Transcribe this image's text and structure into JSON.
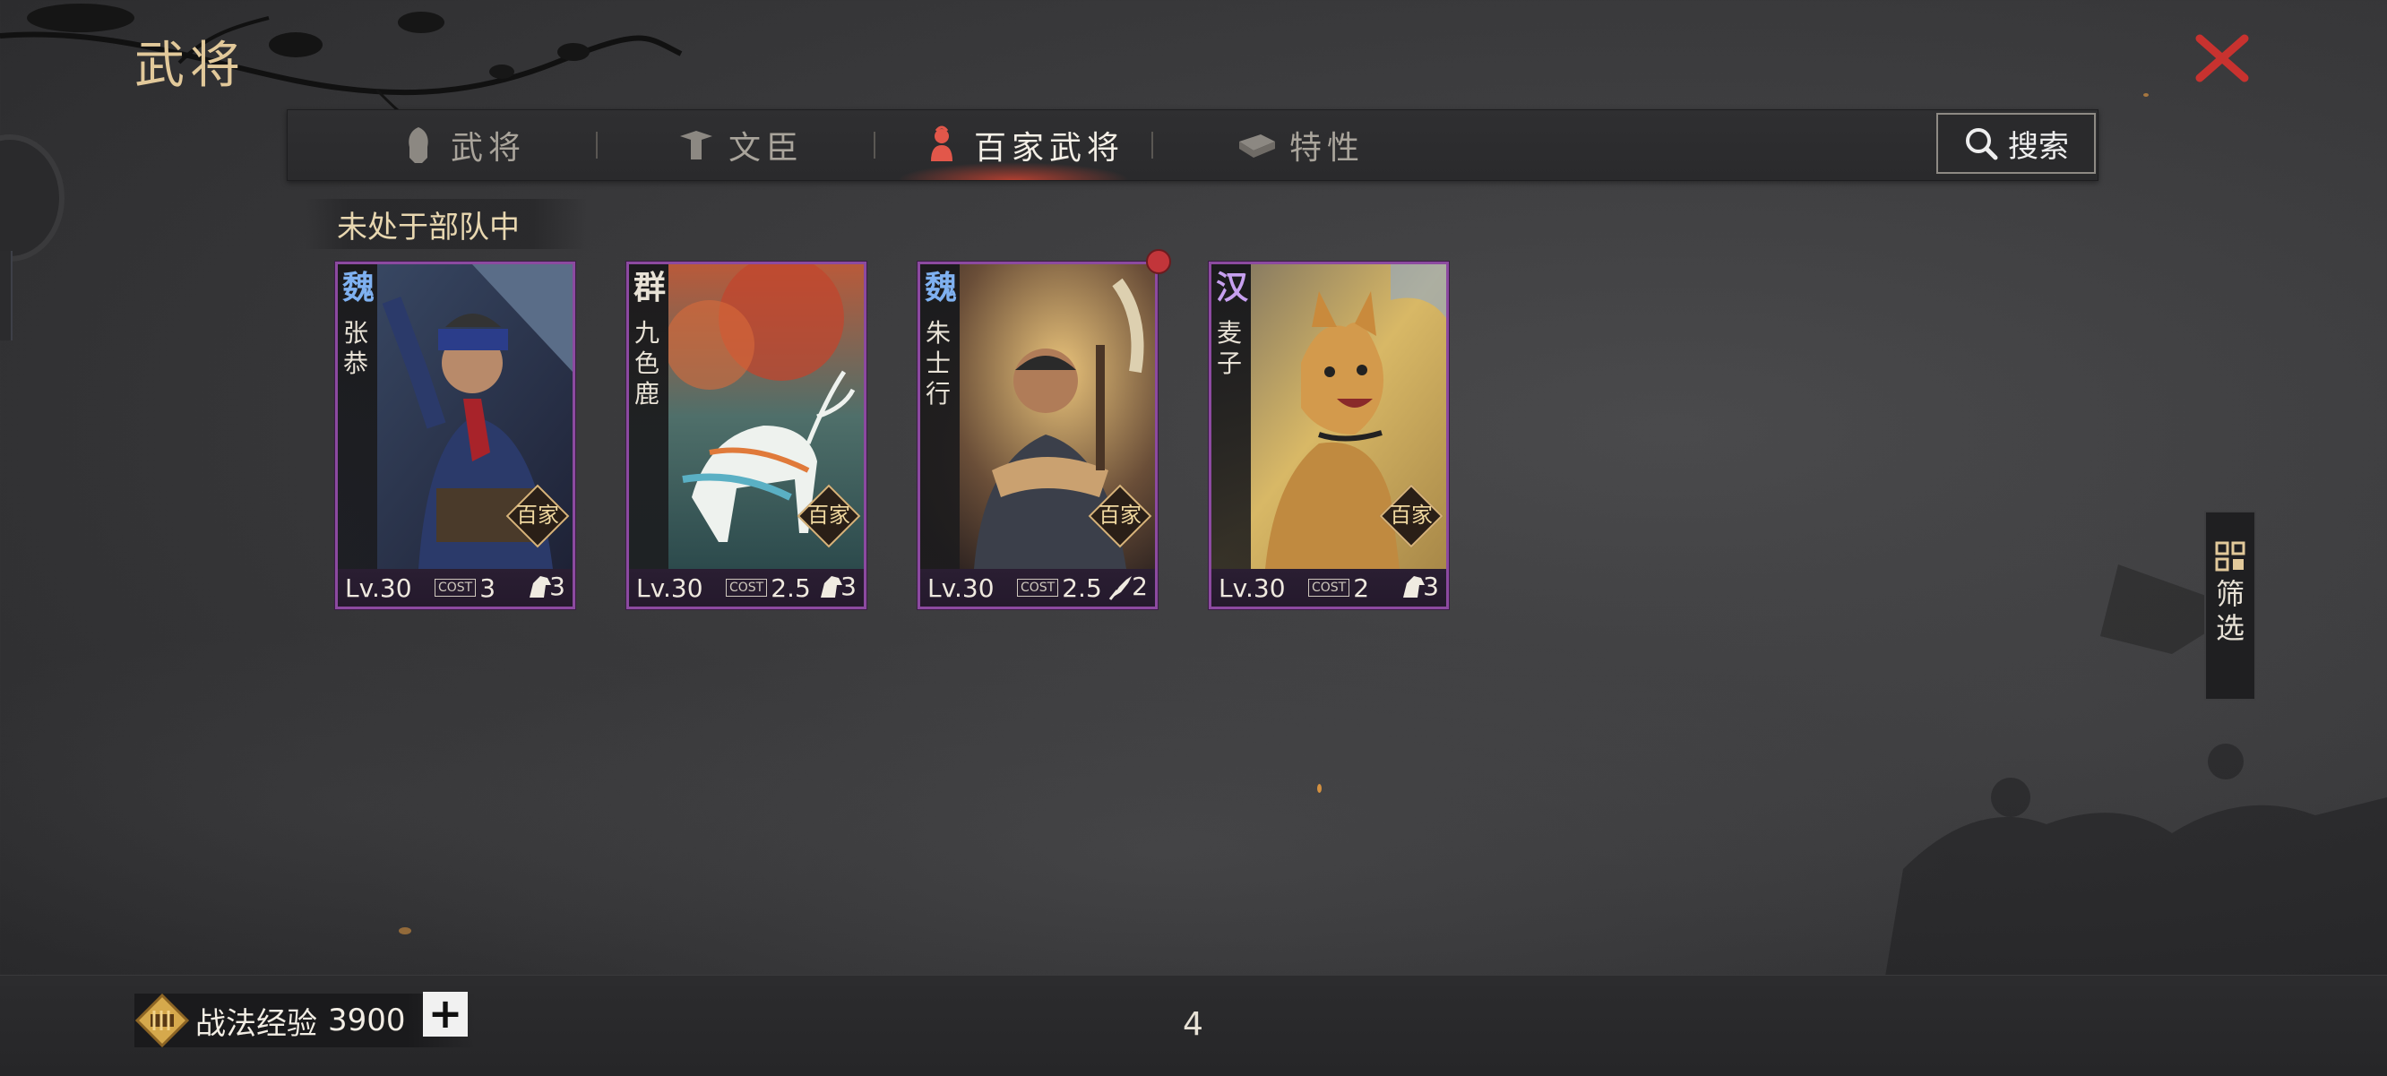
{
  "header": {
    "title": "武将",
    "close_icon": "close-x-icon"
  },
  "tabs": [
    {
      "label": "武将",
      "icon": "helmet-icon",
      "active": false
    },
    {
      "label": "文臣",
      "icon": "scholar-icon",
      "active": false
    },
    {
      "label": "百家武将",
      "icon": "hundred-schools-icon",
      "active": true
    },
    {
      "label": "特性",
      "icon": "trait-book-icon",
      "active": false
    }
  ],
  "search": {
    "label": "搜索",
    "icon": "search-icon"
  },
  "section": {
    "label": "未处于部队中"
  },
  "cards": [
    {
      "faction": "魏",
      "faction_color": "#7fb1f0",
      "name": "张恭",
      "level": "Lv.30",
      "cost": "3",
      "troop": "3",
      "badge": "百家",
      "notification": false
    },
    {
      "faction": "群",
      "faction_color": "#e8e2d6",
      "name": "九色鹿",
      "level": "Lv.30",
      "cost": "2.5",
      "troop": "3",
      "badge": "百家",
      "notification": false
    },
    {
      "faction": "魏",
      "faction_color": "#7fb1f0",
      "name": "朱士行",
      "level": "Lv.30",
      "cost": "2.5",
      "troop": "2",
      "badge": "百家",
      "notification": true
    },
    {
      "faction": "汉",
      "faction_color": "#c7a0f0",
      "name": "麦子",
      "level": "Lv.30",
      "cost": "2",
      "troop": "3",
      "badge": "百家",
      "notification": false
    }
  ],
  "cost_icon_text": "COST",
  "filter": {
    "label": "筛选",
    "icon": "grid-filter-icon"
  },
  "footer": {
    "exp_label": "战法经验",
    "exp_value": "3900",
    "add_label": "+",
    "count": "4"
  },
  "colors": {
    "accent": "#e2c99a",
    "card_border": "#8c4aa0",
    "close": "#c8322f",
    "tab_glow": "#dc4632"
  }
}
